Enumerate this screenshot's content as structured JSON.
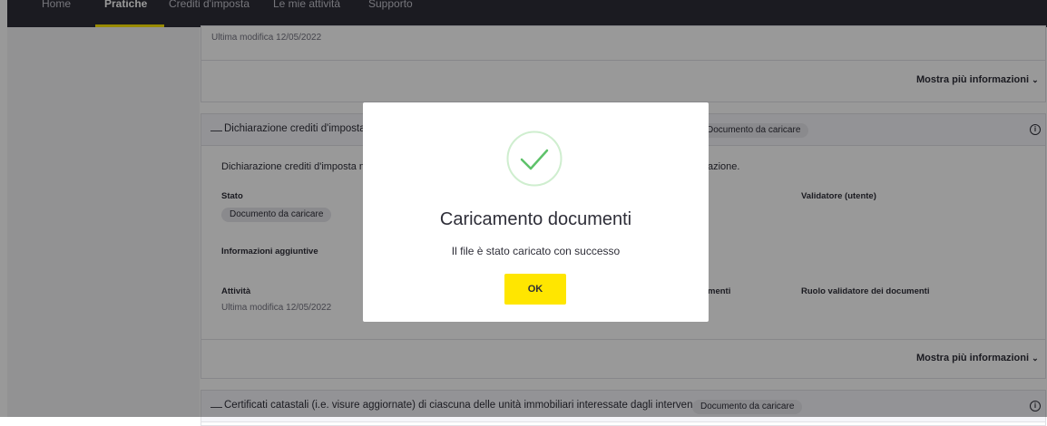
{
  "nav": {
    "items": [
      "Home",
      "Pratiche",
      "Crediti d'imposta",
      "Le mie attività",
      "Supporto"
    ]
  },
  "card_top": {
    "last_modified": "Ultima modifica 12/05/2022",
    "more_info": "Mostra più informazioni"
  },
  "card_main": {
    "title": "Dichiarazione crediti d'imposta",
    "badge": "Documento da caricare",
    "description_start": "Dichiarazione crediti d'imposta n",
    "description_end": "azione.",
    "stato_label": "Stato",
    "stato_badge": "Documento da caricare",
    "validatore_label": "Validatore (utente)",
    "info_label": "Informazioni aggiuntive",
    "attivita_label": "Attività",
    "last_modified": "Ultima modifica 12/05/2022",
    "documenti_label": "menti",
    "ruolo_label": "Ruolo validatore dei documenti",
    "more_info": "Mostra più informazioni"
  },
  "card_bottom": {
    "title": "Certificati catastali (i.e. visure aggiornate) di ciascuna delle unità immobiliari interessate dagli interven...",
    "badge": "Documento da caricare"
  },
  "modal": {
    "title": "Caricamento documenti",
    "message": "Il file è stato caricato con successo",
    "ok_label": "OK"
  },
  "icons": {
    "info": "info-icon",
    "check": "check-icon",
    "chevron": "chevron-down-icon",
    "collapse": "minus-icon"
  },
  "colors": {
    "accent": "#ffe600",
    "dark": "#2e2e38",
    "success": "#5ec26a"
  }
}
